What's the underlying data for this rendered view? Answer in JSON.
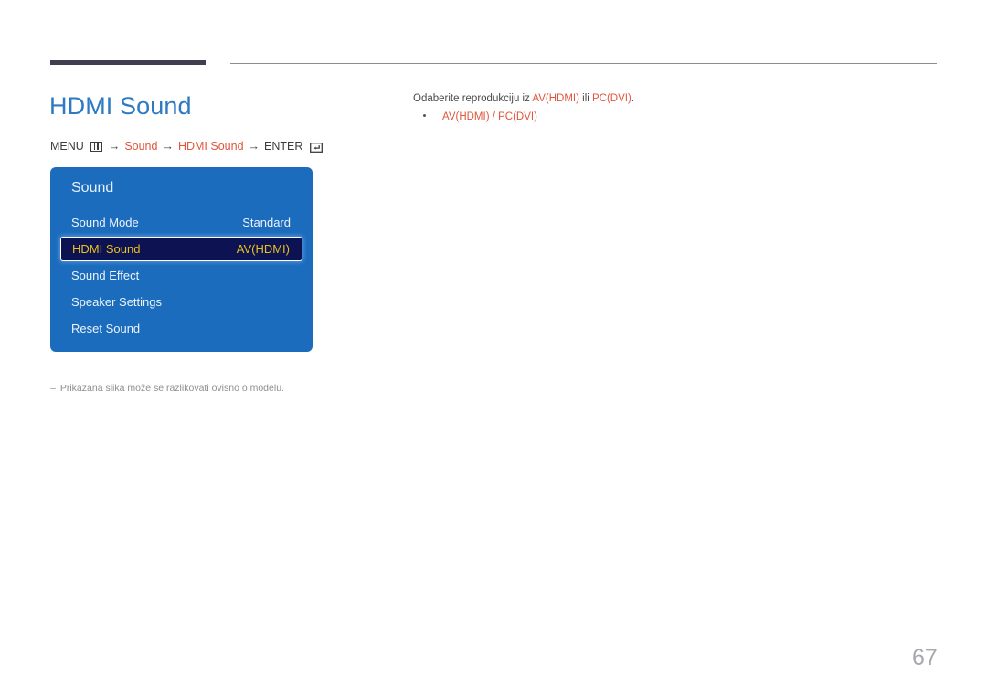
{
  "header": {
    "rule_dark_color": "#3f3f4f",
    "rule_thin_color": "#8d8d91"
  },
  "title": "HDMI Sound",
  "menu_path": {
    "menu_label": "MENU",
    "menu_icon": "menu-box-icon",
    "arrow": "→",
    "step1": "Sound",
    "step2": "HDMI Sound",
    "enter_label": "ENTER",
    "enter_icon": "enter-return-icon",
    "highlight_color": "#e0553c"
  },
  "osd": {
    "title": "Sound",
    "panel_color": "#1c6cbe",
    "selected_bg": "#0d1352",
    "selected_text_color": "#e9c01d",
    "rows": [
      {
        "label": "Sound Mode",
        "value": "Standard",
        "selected": false
      },
      {
        "label": "HDMI Sound",
        "value": "AV(HDMI)",
        "selected": true
      },
      {
        "label": "Sound Effect",
        "value": "",
        "selected": false
      },
      {
        "label": "Speaker Settings",
        "value": "",
        "selected": false
      },
      {
        "label": "Reset Sound",
        "value": "",
        "selected": false
      }
    ]
  },
  "footnote": {
    "dash": "–",
    "text": "Prikazana slika može se razlikovati ovisno o modelu."
  },
  "description": {
    "lead": "Odaberite reprodukciju iz ",
    "term1": "AV(HDMI)",
    "middle": " ili ",
    "term2": "PC(DVI)",
    "tail": ".",
    "bullet": "AV(HDMI) / PC(DVI)"
  },
  "page_number": "67"
}
